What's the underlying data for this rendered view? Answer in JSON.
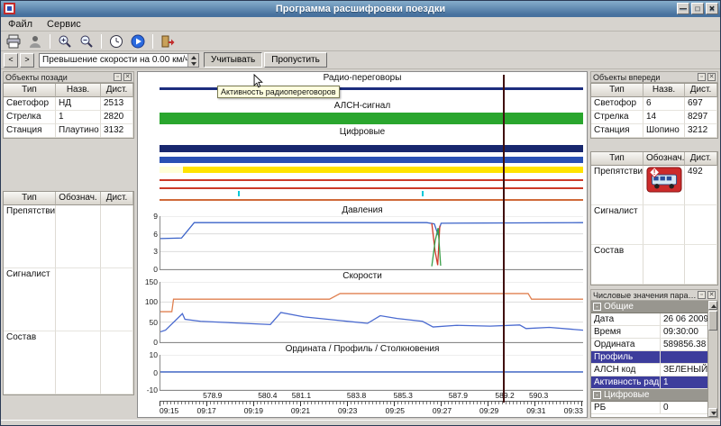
{
  "colors": {
    "selection": "#3d3d9c",
    "tooltip-bg": "#ffffdf"
  },
  "window": {
    "title": "Программа расшифровки поездки",
    "buttons": {
      "minimize": "—",
      "maximize": "□",
      "close": "✕"
    }
  },
  "menubar": {
    "items": [
      {
        "label": "Файл"
      },
      {
        "label": "Сервис"
      }
    ]
  },
  "toolbar": {
    "prev": "<",
    "next": ">",
    "event_combo": "Превышение скорости на 0.00 км/ч",
    "consider": "Учитывать",
    "skip": "Пропустить"
  },
  "left": {
    "title": "Объекты позади",
    "objects_table": {
      "headers": [
        "Тип",
        "Назв.",
        "Дист."
      ],
      "rows": [
        [
          "Светофор",
          "НД",
          "2513"
        ],
        [
          "Стрелка",
          "1",
          "2820"
        ],
        [
          "Станция",
          "Плаутино",
          "3132"
        ]
      ]
    },
    "markers_table": {
      "headers": [
        "Тип",
        "Обознач.",
        "Дист."
      ],
      "rows": [
        [
          "Препятствие",
          "",
          ""
        ],
        [
          "Сигналист",
          "",
          ""
        ],
        [
          "Состав",
          "",
          ""
        ]
      ]
    }
  },
  "right": {
    "title": "Объекты впереди",
    "objects_table": {
      "headers": [
        "Тип",
        "Назв.",
        "Дист."
      ],
      "rows": [
        [
          "Светофор",
          "6",
          "697"
        ],
        [
          "Стрелка",
          "14",
          "8297"
        ],
        [
          "Станция",
          "Шопино",
          "3212"
        ]
      ]
    },
    "markers_table": {
      "headers": [
        "Тип",
        "Обознач.",
        "Дист."
      ],
      "rows": [
        [
          "Препятствие",
          "icon:obstacle-bus",
          "492"
        ],
        [
          "Сигналист",
          "",
          ""
        ],
        [
          "Состав",
          "",
          ""
        ]
      ]
    },
    "numeric": {
      "title": "Числовые значения параметр...",
      "rows": [
        {
          "section": "Общие"
        },
        {
          "label": "Дата",
          "value": "26 06 2009"
        },
        {
          "label": "Время",
          "value": "09:30:00"
        },
        {
          "label": "Ордината",
          "value": "589856.38"
        },
        {
          "label": "Профиль",
          "value": "",
          "selected": true
        },
        {
          "label": "АЛСН код",
          "value": "ЗЕЛЕНЫЙ"
        },
        {
          "label": "Активность радио",
          "value": "1",
          "selected": true
        },
        {
          "section": "Цифровые"
        },
        {
          "label": "РБ",
          "value": "0"
        }
      ]
    }
  },
  "charts": {
    "tooltip": "Активность радиопереговоров",
    "cursor_frac": 0.81,
    "time_labels": [
      {
        "x": 0,
        "t": "09:15"
      },
      {
        "x": 0.111,
        "t": "09:17"
      },
      {
        "x": 0.222,
        "t": "09:19"
      },
      {
        "x": 0.333,
        "t": "09:21"
      },
      {
        "x": 0.444,
        "t": "09:23"
      },
      {
        "x": 0.556,
        "t": "09:25"
      },
      {
        "x": 0.667,
        "t": "09:27"
      },
      {
        "x": 0.778,
        "t": "09:29"
      },
      {
        "x": 0.889,
        "t": "09:31"
      },
      {
        "x": 1,
        "t": "09:33"
      }
    ],
    "ordinate_labels": [
      {
        "x": 0.125,
        "t": "578.9"
      },
      {
        "x": 0.255,
        "t": "580.4"
      },
      {
        "x": 0.335,
        "t": "581.1"
      },
      {
        "x": 0.465,
        "t": "583.8"
      },
      {
        "x": 0.575,
        "t": "585.3"
      },
      {
        "x": 0.705,
        "t": "587.9"
      },
      {
        "x": 0.815,
        "t": "589.2"
      },
      {
        "x": 0.895,
        "t": "590.3"
      }
    ]
  },
  "chart_data": [
    {
      "id": "radio",
      "type": "area",
      "title": "Радио-переговоры",
      "bars": [
        {
          "from": 0,
          "to": 1,
          "top": 4,
          "h": 3,
          "color": "#1c2d7e"
        }
      ]
    },
    {
      "id": "alsn",
      "type": "area",
      "title": "АЛСН-сигнал",
      "bars": [
        {
          "from": 0,
          "to": 1,
          "top": 1,
          "h": 13,
          "color": "#2aa62e"
        }
      ]
    },
    {
      "id": "digital",
      "type": "area",
      "title": "Цифровые",
      "bars": [
        {
          "from": 0,
          "to": 1,
          "top": 8,
          "h": 8,
          "color": "#18276e"
        },
        {
          "from": 0,
          "to": 1,
          "top": 21,
          "h": 7,
          "color": "#2950b4"
        },
        {
          "from": 0,
          "to": 0.055,
          "top": 32,
          "h": 7,
          "color": "#ffffd8"
        },
        {
          "from": 0.055,
          "to": 1,
          "top": 32,
          "h": 7,
          "color": "#ffe300"
        },
        {
          "from": 0,
          "to": 1,
          "top": 46,
          "h": 2,
          "color": "#cc3a28"
        },
        {
          "from": 0,
          "to": 1,
          "top": 55,
          "h": 2,
          "color": "#cc3a28"
        },
        {
          "from": 0,
          "to": 1,
          "top": 68,
          "h": 2,
          "color": "#d06a3a"
        }
      ],
      "ticks": [
        {
          "x": 0.185,
          "top": 59,
          "h": 6,
          "color": "#00c8d8"
        },
        {
          "x": 0.62,
          "top": 59,
          "h": 6,
          "color": "#00c8d8"
        }
      ]
    },
    {
      "id": "pressure",
      "type": "line",
      "title": "Давления",
      "ylim": [
        0,
        9
      ],
      "yticks": [
        0,
        3,
        6,
        9
      ],
      "series": [
        {
          "name": "series1",
          "color": "#3a62c8",
          "points": [
            [
              0,
              5.2
            ],
            [
              0.05,
              5.3
            ],
            [
              0.08,
              7.9
            ],
            [
              0.63,
              7.9
            ],
            [
              0.648,
              7.7
            ],
            [
              0.656,
              6.0
            ],
            [
              0.664,
              7.8
            ],
            [
              1,
              7.9
            ]
          ]
        },
        {
          "name": "series2",
          "color": "#d03a2a",
          "points": [
            [
              0.642,
              7.8
            ],
            [
              0.65,
              3.0
            ],
            [
              0.656,
              0.7
            ],
            [
              0.661,
              7.4
            ]
          ]
        },
        {
          "name": "series3",
          "color": "#3aa04a",
          "points": [
            [
              0.642,
              0.5
            ],
            [
              0.65,
              4.8
            ],
            [
              0.657,
              7.0
            ],
            [
              0.663,
              0.6
            ]
          ]
        }
      ]
    },
    {
      "id": "speed",
      "type": "line",
      "title": "Скорости",
      "ylim": [
        0,
        150
      ],
      "yticks": [
        0,
        50,
        100,
        150
      ],
      "series": [
        {
          "name": "series1",
          "color": "#e08050",
          "points": [
            [
              0,
              76
            ],
            [
              0.027,
              76
            ],
            [
              0.031,
              107
            ],
            [
              0.4,
              107
            ],
            [
              0.425,
              121
            ],
            [
              0.87,
              121
            ],
            [
              0.878,
              107
            ],
            [
              1,
              107
            ]
          ]
        },
        {
          "name": "series2",
          "color": "#4a6ad0",
          "points": [
            [
              0,
              26
            ],
            [
              0.012,
              30
            ],
            [
              0.052,
              71
            ],
            [
              0.058,
              57
            ],
            [
              0.095,
              52
            ],
            [
              0.26,
              44
            ],
            [
              0.285,
              74
            ],
            [
              0.34,
              63
            ],
            [
              0.49,
              47
            ],
            [
              0.52,
              66
            ],
            [
              0.56,
              59
            ],
            [
              0.62,
              52
            ],
            [
              0.645,
              38
            ],
            [
              0.7,
              42
            ],
            [
              0.78,
              40
            ],
            [
              0.85,
              43
            ],
            [
              0.865,
              34
            ],
            [
              0.92,
              37
            ],
            [
              1,
              30
            ]
          ]
        }
      ]
    },
    {
      "id": "ordinate",
      "type": "line",
      "title": "Ордината / Профиль / Столкновения",
      "ylim": [
        -10,
        10
      ],
      "yticks": [
        -10,
        0,
        10
      ],
      "series": [
        {
          "name": "series1",
          "color": "#3a62c8",
          "points": [
            [
              0,
              0.3
            ],
            [
              1,
              0.3
            ]
          ]
        }
      ]
    }
  ]
}
